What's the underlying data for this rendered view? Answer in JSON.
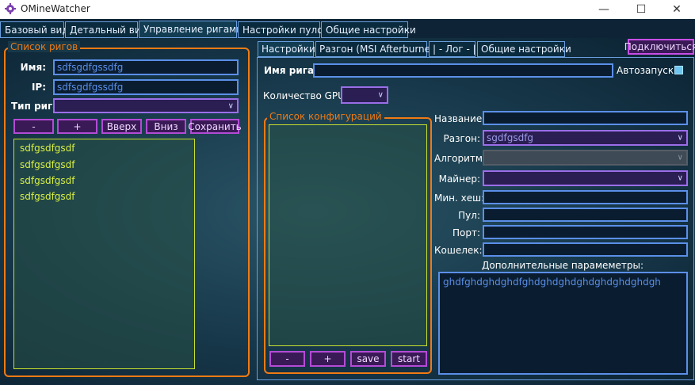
{
  "window": {
    "title": "OMineWatcher",
    "minimize_glyph": "—",
    "maximize_glyph": "☐",
    "close_glyph": "✕"
  },
  "main_tabs": [
    {
      "label": "Базовый вид"
    },
    {
      "label": "Детальный вид"
    },
    {
      "label": "Управление ригами"
    },
    {
      "label": "Настройки пулов"
    },
    {
      "label": "Общие настройки"
    }
  ],
  "rig_list_panel": {
    "title": "Список ригов",
    "name_label": "Имя:",
    "name_value": "sdfsgdfgssdfg",
    "ip_label": "IP:",
    "ip_value": "sdfsgdfgssdfg",
    "type_label": "Тип рига:",
    "type_value": "",
    "buttons": {
      "remove": "-",
      "add": "+",
      "up": "Вверх",
      "down": "Вниз",
      "save": "Сохранить"
    },
    "rigs": [
      "sdfgsdfgsdf",
      "sdfgsdfgsdf",
      "sdfgsdfgsdf",
      "sdfgsdfgsdf"
    ]
  },
  "settings_panel": {
    "tabs": [
      {
        "label": "Настройки"
      },
      {
        "label": "Разгон (MSI Afterburner)"
      },
      {
        "label": "| - Лог - |"
      },
      {
        "label": "Общие настройки"
      }
    ],
    "connect_button": "Подключиться",
    "rig_name_label": "Имя рига:",
    "rig_name_value": "",
    "autostart_label": "Автозапуск:",
    "gpu_count_label": "Количество GPU:",
    "gpu_count_value": "",
    "config_list": {
      "title": "Список конфигураций",
      "buttons": {
        "remove": "-",
        "add": "+",
        "save": "save",
        "start": "start"
      }
    },
    "config_form": {
      "name_label": "Название:",
      "name_value": "",
      "overclock_label": "Разгон:",
      "overclock_value": "sgdfgsdfg",
      "algorithm_label": "Алгоритм:",
      "algorithm_value": "",
      "miner_label": "Майнер:",
      "miner_value": "",
      "min_hash_label": "Мин. хеш:",
      "min_hash_value": "",
      "pool_label": "Пул:",
      "pool_value": "",
      "port_label": "Порт:",
      "port_value": "",
      "wallet_label": "Кошелек:",
      "wallet_value": "",
      "extra_params_label": "Дополнительные парамеметры:",
      "extra_params_value": "ghdfghdghdghdfghdghdghdghdghdghdghdgh"
    }
  },
  "colors": {
    "orange_accent": "#f07a14",
    "blue_input_border": "#5b8fe8",
    "purple_button_border": "#b44bd6",
    "list_text": "#d8f040",
    "checkbox_fill": "#6ec6f0"
  }
}
